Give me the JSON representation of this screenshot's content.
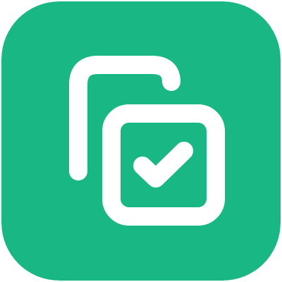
{
  "icon": {
    "name": "copy-check-icon",
    "background_color": "#19B784",
    "stroke_color": "#FFFFFF"
  }
}
